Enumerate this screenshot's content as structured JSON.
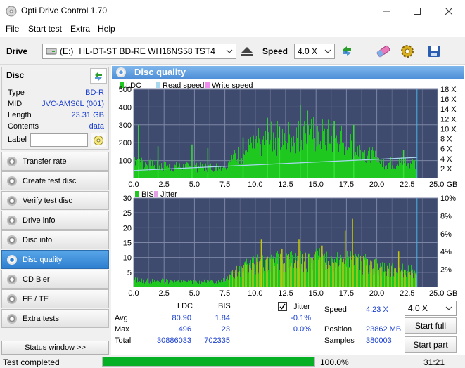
{
  "window": {
    "title": "Opti Drive Control 1.70"
  },
  "menu": [
    "File",
    "Start test",
    "Extra",
    "Help"
  ],
  "toolbar": {
    "drive_label": "Drive",
    "drive_letter": "(E:)",
    "drive_name": "HL-DT-ST BD-RE  WH16NS58 TST4",
    "speed_label": "Speed",
    "speed_value": "4.0 X"
  },
  "disc": {
    "header": "Disc",
    "type_label": "Type",
    "type_value": "BD-R",
    "mid_label": "MID",
    "mid_value": "JVC-AMS6L (001)",
    "length_label": "Length",
    "length_value": "23.31 GB",
    "contents_label": "Contents",
    "contents_value": "data",
    "label_label": "Label",
    "label_value": ""
  },
  "nav": [
    "Transfer rate",
    "Create test disc",
    "Verify test disc",
    "Drive info",
    "Disc info",
    "Disc quality",
    "CD Bler",
    "FE / TE",
    "Extra tests"
  ],
  "nav_active": "Disc quality",
  "status_window_btn": "Status window >>",
  "statusbar": {
    "text": "Test completed",
    "progress": 1.0,
    "progress_text": "100.0%",
    "time": "31:21"
  },
  "panel": {
    "title": "Disc quality"
  },
  "chart_data": [
    {
      "type": "line",
      "legend": [
        "LDC",
        "Read speed",
        "Write speed"
      ],
      "colors": {
        "LDC": "#1ec81e",
        "Read speed": "#a8d8f0",
        "Write speed": "#f08cf0"
      },
      "x_ticks": [
        "0.0",
        "2.5",
        "5.0",
        "7.5",
        "10.0",
        "12.5",
        "15.0",
        "17.5",
        "20.0",
        "22.5",
        "25.0 GB"
      ],
      "y_ticks_left": [
        "500",
        "400",
        "300",
        "200",
        "100"
      ],
      "y_ticks_right": [
        "18 X",
        "16 X",
        "14 X",
        "12 X",
        "10 X",
        "8 X",
        "6 X",
        "4 X",
        "2 X"
      ],
      "xlim": [
        0,
        25
      ],
      "ylim": [
        0,
        500
      ],
      "y2lim": [
        0,
        18
      ],
      "ldc_envelope_x": [
        0,
        0.5,
        1,
        2,
        3,
        4,
        5,
        6,
        7,
        7.8,
        8.5,
        9.5,
        10.5,
        11.5,
        12.5,
        13.5,
        14.5,
        15.5,
        16.5,
        17.5,
        18.5,
        19.5,
        20.5,
        21.5,
        22.5,
        23.3
      ],
      "ldc_envelope_y": [
        140,
        120,
        90,
        85,
        80,
        78,
        75,
        75,
        80,
        120,
        150,
        200,
        250,
        270,
        280,
        285,
        300,
        290,
        270,
        250,
        200,
        150,
        110,
        100,
        110,
        100
      ],
      "ldc_spikes": [
        [
          0.4,
          300
        ],
        [
          2.0,
          180
        ],
        [
          4.8,
          190
        ],
        [
          6.1,
          170
        ],
        [
          9.0,
          230
        ],
        [
          11.0,
          340
        ],
        [
          12.0,
          290
        ],
        [
          13.7,
          410
        ],
        [
          14.3,
          380
        ],
        [
          16.5,
          320
        ],
        [
          18.1,
          300
        ],
        [
          22.2,
          160
        ]
      ],
      "read_speed_x": [
        0,
        23.3
      ],
      "read_speed_y": [
        1.6,
        4.23
      ],
      "end_marker_x": 23.31
    },
    {
      "type": "line",
      "legend": [
        "BIS",
        "Jitter"
      ],
      "colors": {
        "BIS": "#1ec81e",
        "Jitter": "#e6a0e6"
      },
      "x_ticks": [
        "0.0",
        "2.5",
        "5.0",
        "7.5",
        "10.0",
        "12.5",
        "15.0",
        "17.5",
        "20.0",
        "22.5",
        "25.0 GB"
      ],
      "y_ticks_left": [
        "30",
        "25",
        "20",
        "15",
        "10",
        "5"
      ],
      "y_ticks_right": [
        "10%",
        "8%",
        "6%",
        "4%",
        "2%"
      ],
      "xlim": [
        0,
        25
      ],
      "ylim": [
        0,
        30
      ],
      "bis_envelope_x": [
        0,
        1,
        2,
        3,
        4,
        5,
        6,
        7,
        7.8,
        8.5,
        9.5,
        10.5,
        11.5,
        12.5,
        13.5,
        14.5,
        15.5,
        16.5,
        17.5,
        18.5,
        19.5,
        20.5,
        21.5,
        22.5,
        23.3
      ],
      "bis_envelope_y": [
        3,
        2.5,
        2.5,
        2.5,
        2.2,
        2.2,
        2.2,
        2.5,
        4.5,
        7,
        8.5,
        9.5,
        10,
        10.5,
        10,
        11,
        11,
        10,
        10.5,
        10,
        9,
        7.5,
        6.5,
        7,
        5
      ],
      "bis_spikes": [
        [
          10.5,
          16
        ],
        [
          12.2,
          13
        ],
        [
          13.6,
          16
        ],
        [
          15.5,
          14
        ],
        [
          17.4,
          19
        ],
        [
          18.0,
          23
        ],
        [
          21.8,
          12
        ]
      ],
      "end_marker_x": 23.31
    }
  ],
  "stats": {
    "col_headers": [
      "LDC",
      "BIS"
    ],
    "jitter_label": "Jitter",
    "jitter_checked": true,
    "rows": [
      {
        "label": "Avg",
        "ldc": "80.90",
        "bis": "1.84",
        "jitter": "-0.1%"
      },
      {
        "label": "Max",
        "ldc": "496",
        "bis": "23",
        "jitter": "0.0%"
      },
      {
        "label": "Total",
        "ldc": "30886033",
        "bis": "702335"
      }
    ],
    "speed_label": "Speed",
    "speed_value": "4.23 X",
    "position_label": "Position",
    "position_value": "23862 MB",
    "samples_label": "Samples",
    "samples_value": "380003",
    "speed_select": "4.0 X",
    "start_full": "Start full",
    "start_part": "Start part"
  }
}
